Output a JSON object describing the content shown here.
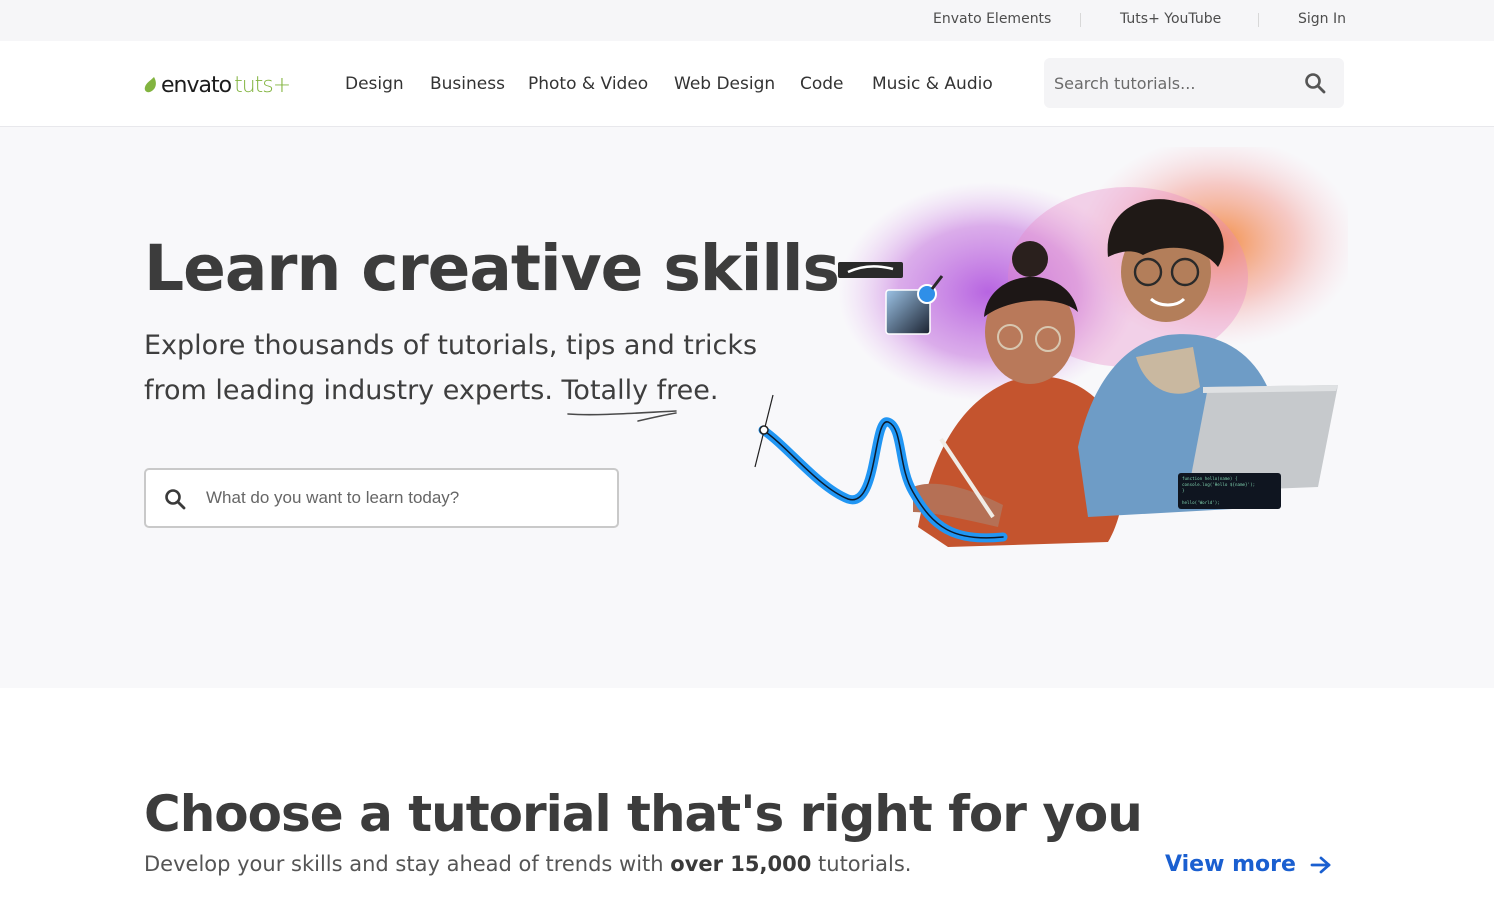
{
  "utility_bar": {
    "links": [
      "Envato Elements",
      "Tuts+ YouTube",
      "Sign In"
    ]
  },
  "header": {
    "logo": {
      "word1": "envato",
      "word2": "tuts+"
    },
    "nav": [
      "Design",
      "Business",
      "Photo & Video",
      "Web Design",
      "Code",
      "Music & Audio"
    ],
    "search": {
      "placeholder": "Search tutorials..."
    }
  },
  "hero": {
    "title": "Learn creative skills",
    "subtitle_line1": "Explore thousands of tutorials, tips and tricks",
    "subtitle_line2_pre": "from leading industry experts. ",
    "subtitle_line2_emph": "Totally free.",
    "search": {
      "placeholder": "What do you want to learn today?"
    },
    "code_snippet": [
      "function hello(name) {",
      "  console.log('Hello ${name}');",
      "}",
      "",
      "hello('World');"
    ]
  },
  "tutorials_section": {
    "title": "Choose a tutorial that's right for you",
    "subtitle_pre": "Develop your skills and stay ahead of trends with ",
    "subtitle_strong": "over 15,000",
    "subtitle_post": " tutorials.",
    "view_more": "View more"
  },
  "colors": {
    "brand_green": "#82b440",
    "link_blue": "#1a5fd0",
    "hero_bg": "#f8f8fa"
  },
  "icons": [
    "leaf-icon",
    "search-icon",
    "arrow-right-icon"
  ]
}
